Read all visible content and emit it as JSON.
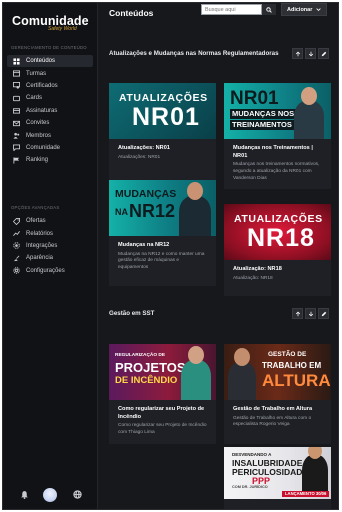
{
  "sidebar": {
    "logo_main": "Comunidade",
    "logo_sub": "Safety World",
    "section1_title": "Gerenciamento de conteúdo",
    "section2_title": "Opções avançadas",
    "items1": [
      {
        "label": "Conteúdos",
        "icon": "content-icon",
        "active": true
      },
      {
        "label": "Turmas",
        "icon": "classes-icon"
      },
      {
        "label": "Certificados",
        "icon": "certificate-icon"
      },
      {
        "label": "Cards",
        "icon": "cards-icon"
      },
      {
        "label": "Assinaturas",
        "icon": "subscriptions-icon"
      },
      {
        "label": "Convites",
        "icon": "invite-icon"
      },
      {
        "label": "Membros",
        "icon": "members-icon"
      },
      {
        "label": "Comunidade",
        "icon": "community-icon"
      },
      {
        "label": "Ranking",
        "icon": "ranking-icon"
      }
    ],
    "items2": [
      {
        "label": "Ofertas",
        "icon": "offers-icon"
      },
      {
        "label": "Relatórios",
        "icon": "reports-icon"
      },
      {
        "label": "Integrações",
        "icon": "integrations-icon"
      },
      {
        "label": "Aparência",
        "icon": "appearance-icon"
      },
      {
        "label": "Configurações",
        "icon": "settings-icon"
      }
    ]
  },
  "header": {
    "title": "Conteúdos",
    "search_placeholder": "Busque aqui",
    "add_label": "Adicionar"
  },
  "sections": [
    {
      "title": "Atualizações e Mudanças nas Normas Regulamentadoras",
      "cards": [
        {
          "thumb_line1": "ATUALIZAÇÕES",
          "thumb_line2": "NR01",
          "title": "Atualizações: NR01",
          "sub": "Atualizações: NR01"
        },
        {
          "thumb_line1": "NR01",
          "thumb_line2": "MUDANÇAS NOS",
          "thumb_line3": "TREINAMENTOS",
          "title": "Mudanças nos Treinamentos | NR01",
          "sub": "Mudanças nos treinamentos normativos, segundo a atualização da NR01 com Vanderson Dias"
        },
        {
          "thumb_line1": "MUDANÇAS",
          "thumb_line2": "NA",
          "thumb_line3": "NR12",
          "title": "Mudanças na NR12",
          "sub": "Mudanças na NR12 e como manter uma gestão eficaz de máquinas e equipamentos"
        },
        {
          "thumb_line1": "ATUALIZAÇÕES",
          "thumb_line2": "NR18",
          "title": "Atualização: NR18",
          "sub": "Atualização: NR18"
        }
      ]
    },
    {
      "title": "Gestão em SST",
      "cards": [
        {
          "thumb_line1": "REGULARIZAÇÃO DE",
          "thumb_line2": "PROJETOS",
          "thumb_line3": "DE INCÊNDIO",
          "title": "Como regularizar seu Projeto de Incêndio",
          "sub": "Como regularizar seu Projeto de Incêndio com Thiago Lima"
        },
        {
          "thumb_line1": "GESTÃO DE",
          "thumb_line2": "TRABALHO EM",
          "thumb_line3": "ALTURA",
          "title": "Gestão de Trabalho em Altura",
          "sub": "Gestão de Trabalho em Altura com o especialista Rogerio Veiga"
        },
        {
          "thumb_line1": "DESVENDANDO A",
          "thumb_line2": "INSALUBRIDADE",
          "thumb_line3": "PERICULOSIDADE",
          "thumb_line4": "PPP",
          "thumb_line5": "COM DR. JURÍDICO",
          "thumb_badge": "LANÇAMENTO 30/06"
        }
      ]
    }
  ],
  "colors": {
    "background": "#17181c",
    "sidebar": "#111215",
    "accent_red": "#c8102e",
    "accent_teal": "#1fb8b0",
    "logo_gold": "#d4a23a"
  }
}
